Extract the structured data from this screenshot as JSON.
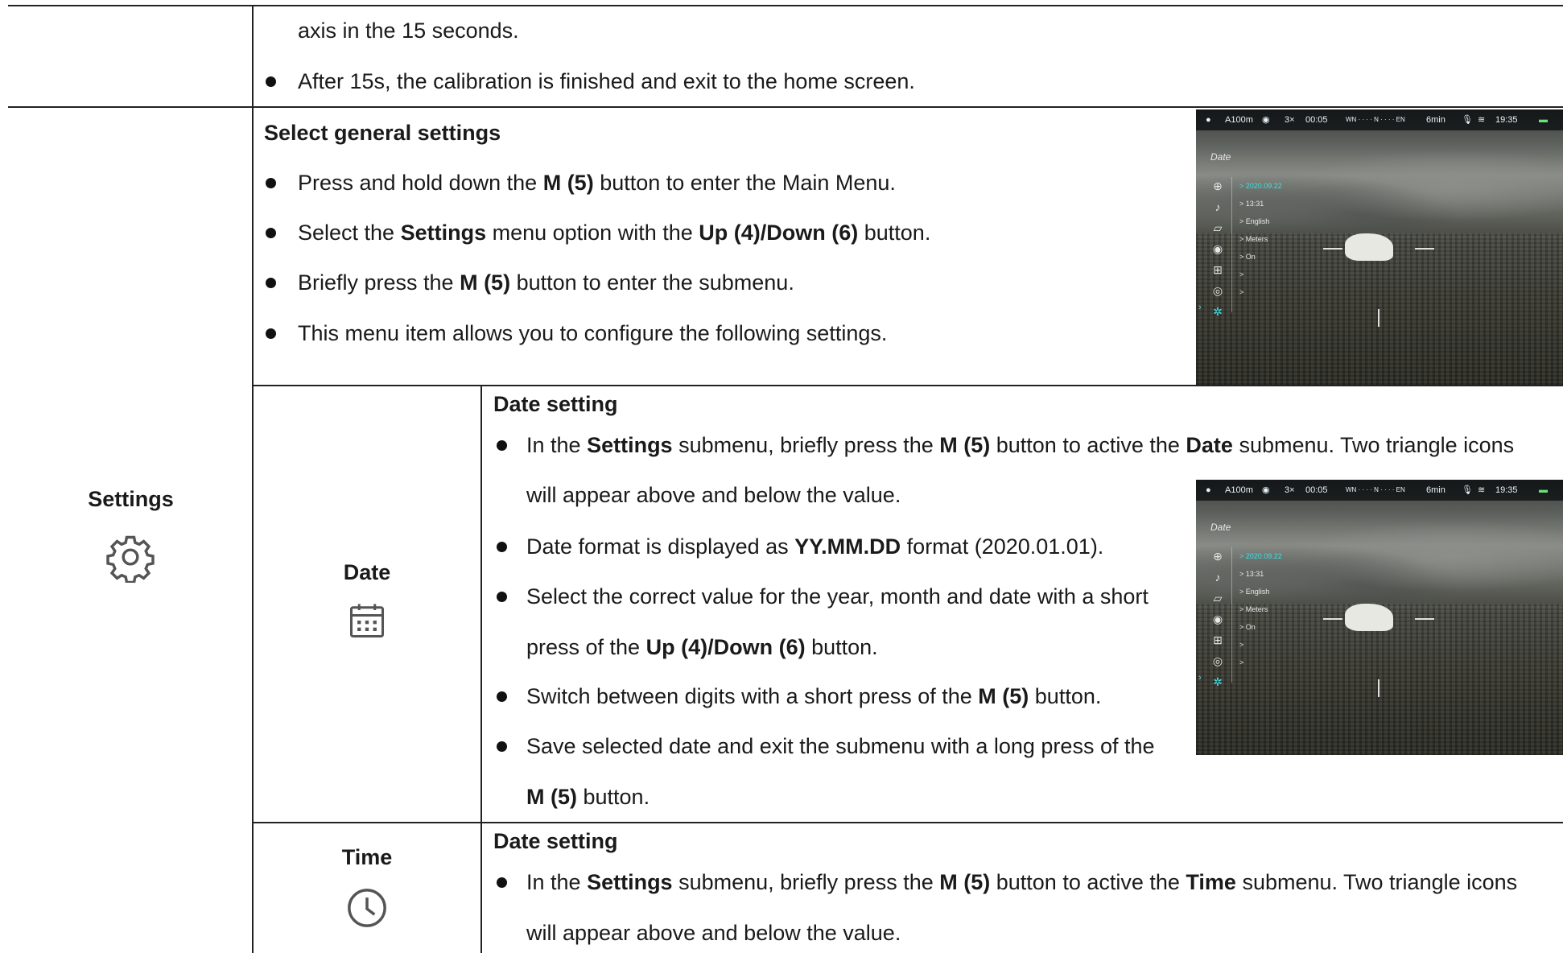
{
  "row_top": {
    "line1": "axis in the 15 seconds.",
    "bullet1": "After 15s, the calibration is finished and exit to the home screen."
  },
  "settings": {
    "label": "Settings",
    "icon": "gear-icon",
    "heading": "Select general settings",
    "b1_pre": "Press and hold down the ",
    "b1_bold": "M (5)",
    "b1_post": " button to enter the Main Menu.",
    "b2_pre": "Select the ",
    "b2_bold1": "Settings",
    "b2_mid": " menu option with the ",
    "b2_bold2": "Up (4)/Down (6)",
    "b2_post": " button.",
    "b3_pre": "Briefly press the ",
    "b3_bold": "M (5)",
    "b3_post": " button to enter the submenu.",
    "b4": "This menu item allows you to configure the following settings."
  },
  "date": {
    "label": "Date",
    "icon": "calendar-icon",
    "heading": "Date setting",
    "b1_pre": "In the ",
    "b1_bold1": "Settings",
    "b1_mid": " submenu, briefly press the ",
    "b1_bold2": "M (5)",
    "b1_mid2": " button to active the ",
    "b1_bold3": "Date",
    "b1_post": " submenu. Two triangle icons",
    "b1_line2": "will appear above and below the value.",
    "b2_pre": "Date format is displayed as ",
    "b2_bold": "YY.MM.DD",
    "b2_post": " format (2020.01.01).",
    "b3_line1": "Select the correct value for the year, month and date with a short",
    "b3_pre": "press of the ",
    "b3_bold": "Up (4)/Down (6)",
    "b3_post": " button.",
    "b4_pre": "Switch between digits with a short press of the ",
    "b4_bold": "M (5)",
    "b4_post": " button.",
    "b5_line1": "Save selected date and exit the submenu with a long press of the",
    "b5_bold": "M (5)",
    "b5_post": " button."
  },
  "time": {
    "label": "Time",
    "icon": "clock-icon",
    "heading": "Date setting",
    "b1_pre": "In the ",
    "b1_bold1": "Settings",
    "b1_mid": " submenu, briefly press the ",
    "b1_bold2": "M (5)",
    "b1_mid2": " button to active the ",
    "b1_bold3": "Time",
    "b1_post": " submenu. Two triangle icons",
    "b1_line2": "will appear above and below the value."
  },
  "device_screen": {
    "status": {
      "range": "A100m",
      "zoom": "3×",
      "rec": "00:05",
      "compass": "WN · · · · N · · · · EN",
      "battery_time": "6min",
      "clock": "19:35"
    },
    "menu_title": "Date",
    "items": [
      "> 2020.09.22",
      "> 13:31",
      "> English",
      "> Meters",
      "> On",
      ">",
      ">"
    ],
    "accent_color": "#3fe0e8"
  }
}
